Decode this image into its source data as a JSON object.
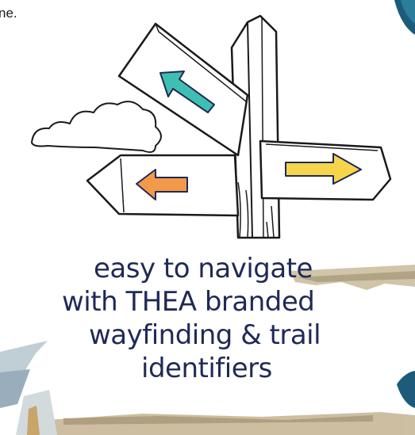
{
  "top_text": "ne.",
  "caption": {
    "line1": "easy to navigate",
    "line2": "with THEA branded",
    "line3": "wayfinding & trail",
    "line4": "identifiers"
  },
  "colors": {
    "navy": "#1f2a56",
    "teal_arrow": "#3fbfb3",
    "orange_arrow": "#f39a4a",
    "yellow_arrow": "#f6d54a",
    "teal_corner": "#1c5c7a",
    "paper_tan": "#b9a98a"
  },
  "icons": [
    "signpost-icon",
    "cloud-icon",
    "arrow-up-left-icon",
    "arrow-left-icon",
    "arrow-right-icon"
  ]
}
